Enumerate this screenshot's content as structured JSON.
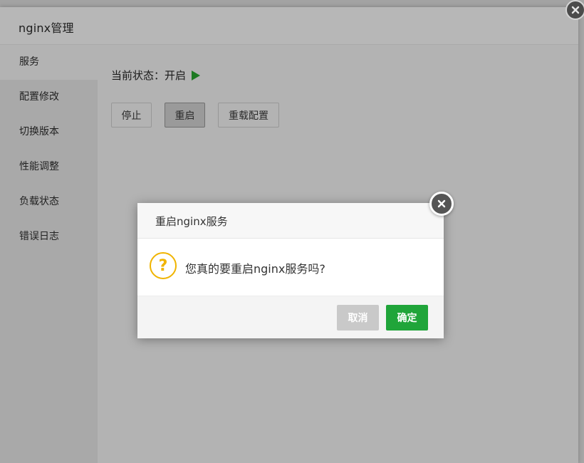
{
  "window": {
    "title": "nginx管理"
  },
  "sidebar": {
    "items": [
      {
        "label": "服务",
        "active": true
      },
      {
        "label": "配置修改",
        "active": false
      },
      {
        "label": "切换版本",
        "active": false
      },
      {
        "label": "性能调整",
        "active": false
      },
      {
        "label": "负载状态",
        "active": false
      },
      {
        "label": "错误日志",
        "active": false
      }
    ]
  },
  "service": {
    "status_label": "当前状态：开启",
    "status_icon": "play-icon",
    "status_color": "#1d7a22",
    "buttons": {
      "stop": "停止",
      "restart": "重启",
      "reload": "重载配置"
    }
  },
  "dialog": {
    "title": "重启nginx服务",
    "message": "您真的要重启nginx服务吗?",
    "icon": "question-icon",
    "icon_color": "#f0b400",
    "cancel_label": "取消",
    "ok_label": "确定",
    "ok_color": "#20a53a"
  }
}
